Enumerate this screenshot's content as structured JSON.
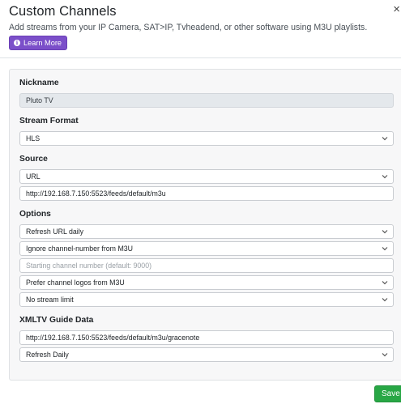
{
  "header": {
    "title": "Custom Channels",
    "close_glyph": "×",
    "subtitle": "Add streams from your IP Camera, SAT>IP, Tvheadend, or other software using M3U playlists.",
    "learn_more_label": "Learn More",
    "learn_more_icon": "info-circle-icon",
    "learn_more_color": "#7b4fc9"
  },
  "form": {
    "nickname": {
      "label": "Nickname",
      "value": "Pluto TV"
    },
    "stream_format": {
      "label": "Stream Format",
      "value": "HLS"
    },
    "source": {
      "label": "Source",
      "type_value": "URL",
      "url_value": "http://192.168.7.150:5523/feeds/default/m3u"
    },
    "options": {
      "label": "Options",
      "refresh_value": "Refresh URL daily",
      "channel_number_mode": "Ignore channel-number from M3U",
      "starting_channel_placeholder": "Starting channel number (default: 9000)",
      "logos_value": "Prefer channel logos from M3U",
      "stream_limit_value": "No stream limit"
    },
    "xmltv": {
      "label": "XMLTV Guide Data",
      "url_value": "http://192.168.7.150:5523/feeds/default/m3u/gracenote",
      "refresh_value": "Refresh Daily"
    }
  },
  "footer": {
    "save_label": "Save",
    "save_color": "#28a745"
  }
}
